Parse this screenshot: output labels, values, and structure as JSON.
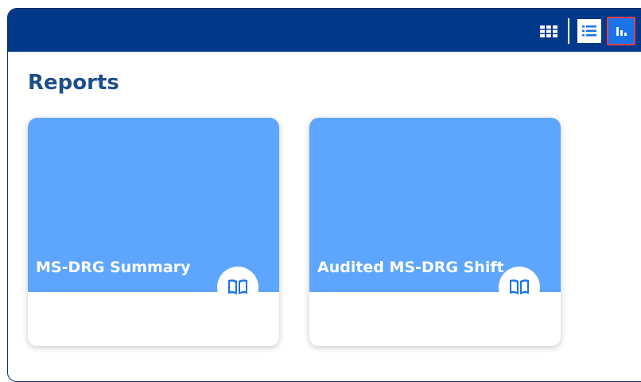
{
  "header": {
    "view_buttons": [
      {
        "name": "grid-view",
        "icon": "grid-icon"
      },
      {
        "name": "list-view",
        "icon": "list-icon"
      },
      {
        "name": "chart-view",
        "icon": "bar-chart-icon",
        "selected": true
      }
    ]
  },
  "main": {
    "title": "Reports",
    "cards": [
      {
        "title": "MS-DRG Summary",
        "icon": "book-icon"
      },
      {
        "title": "Audited MS-DRG Shift",
        "icon": "book-icon"
      }
    ]
  },
  "colors": {
    "header_bg": "#03398a",
    "card_top": "#5ea6fd",
    "title_text": "#1d4e89",
    "selected_btn": "#1a73e8",
    "highlight_border": "#e53d4c"
  }
}
